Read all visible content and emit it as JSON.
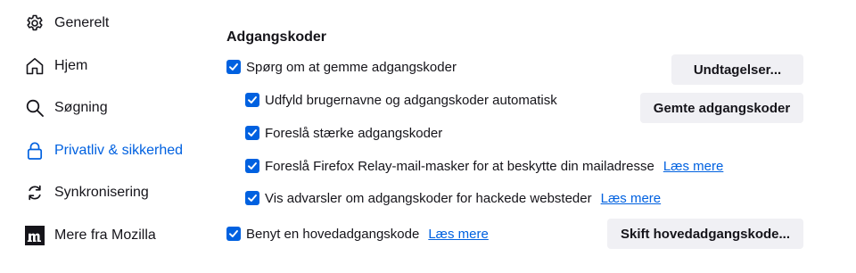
{
  "sidebar": {
    "items": [
      {
        "label": "Generelt",
        "icon": "gear-icon"
      },
      {
        "label": "Hjem",
        "icon": "home-icon"
      },
      {
        "label": "Søgning",
        "icon": "search-icon"
      },
      {
        "label": "Privatliv & sikkerhed",
        "icon": "lock-icon",
        "active": true
      },
      {
        "label": "Synkronisering",
        "icon": "sync-icon"
      },
      {
        "label": "Mere fra Mozilla",
        "icon": "mozilla-logo-icon"
      }
    ]
  },
  "passwords": {
    "heading": "Adgangskoder",
    "ask_to_save": {
      "label": "Spørg om at gemme adgangskoder",
      "checked": true
    },
    "autofill": {
      "label": "Udfyld brugernavne og adgangskoder automatisk",
      "checked": true
    },
    "suggest_strong": {
      "label": "Foreslå stærke adgangskoder",
      "checked": true
    },
    "relay_masks": {
      "label": "Foreslå Firefox Relay-mail-masker for at beskytte din mailadresse",
      "checked": true,
      "learn_more": "Læs mere"
    },
    "breach_alerts": {
      "label": "Vis advarsler om adgangskoder for hackede websteder",
      "checked": true,
      "learn_more": "Læs mere"
    },
    "primary_password": {
      "label": "Benyt en hovedadgangskode",
      "checked": true,
      "learn_more": "Læs mere"
    },
    "exceptions_button": "Undtagelser...",
    "saved_logins_button": "Gemte adgangskoder",
    "change_primary_button": "Skift hovedadgangskode..."
  },
  "colors": {
    "accent": "#0061e0",
    "button_bg": "#f0f0f4",
    "text": "#15141a"
  }
}
